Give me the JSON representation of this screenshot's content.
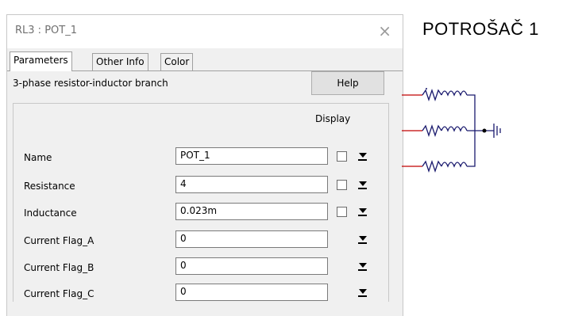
{
  "dialog": {
    "title": "RL3 : POT_1",
    "close_symbol": "×",
    "tabs": [
      "Parameters",
      "Other Info",
      "Color"
    ],
    "description": "3-phase resistor-inductor branch",
    "help_label": "Help",
    "display_header": "Display",
    "params": [
      {
        "label": "Name",
        "value": "POT_1",
        "has_checkbox": true
      },
      {
        "label": "Resistance",
        "value": "4",
        "has_checkbox": true
      },
      {
        "label": "Inductance",
        "value": "0.023m",
        "has_checkbox": true
      },
      {
        "label": "Current Flag_A",
        "value": "0",
        "has_checkbox": false
      },
      {
        "label": "Current Flag_B",
        "value": "0",
        "has_checkbox": false
      },
      {
        "label": "Current Flag_C",
        "value": "0",
        "has_checkbox": false
      }
    ]
  },
  "canvas": {
    "heading": "POTROŠAČ 1",
    "wire_color": "#c00000"
  },
  "icons": [
    "close-icon",
    "dropdown-arrow-icon",
    "resistor-icon",
    "inductor-icon",
    "ground-icon"
  ]
}
